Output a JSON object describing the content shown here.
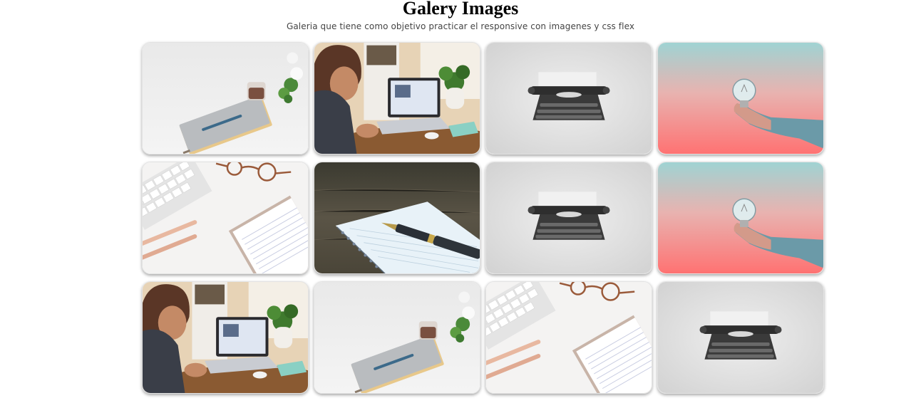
{
  "header": {
    "title": "Galery Images",
    "subtitle": "Galeria que tiene como objetivo practicar el responsive con imagenes y css flex"
  },
  "gallery": {
    "images": [
      {
        "subject": "notebook-pen-coffee"
      },
      {
        "subject": "girl-laptop"
      },
      {
        "subject": "typewriter"
      },
      {
        "subject": "lightbulb-hand"
      },
      {
        "subject": "keyboard-glasses-notepad"
      },
      {
        "subject": "fountain-pen-notebook"
      },
      {
        "subject": "typewriter"
      },
      {
        "subject": "lightbulb-hand"
      },
      {
        "subject": "girl-laptop"
      },
      {
        "subject": "notebook-pen-coffee"
      },
      {
        "subject": "keyboard-glasses-notepad"
      },
      {
        "subject": "typewriter"
      }
    ]
  }
}
